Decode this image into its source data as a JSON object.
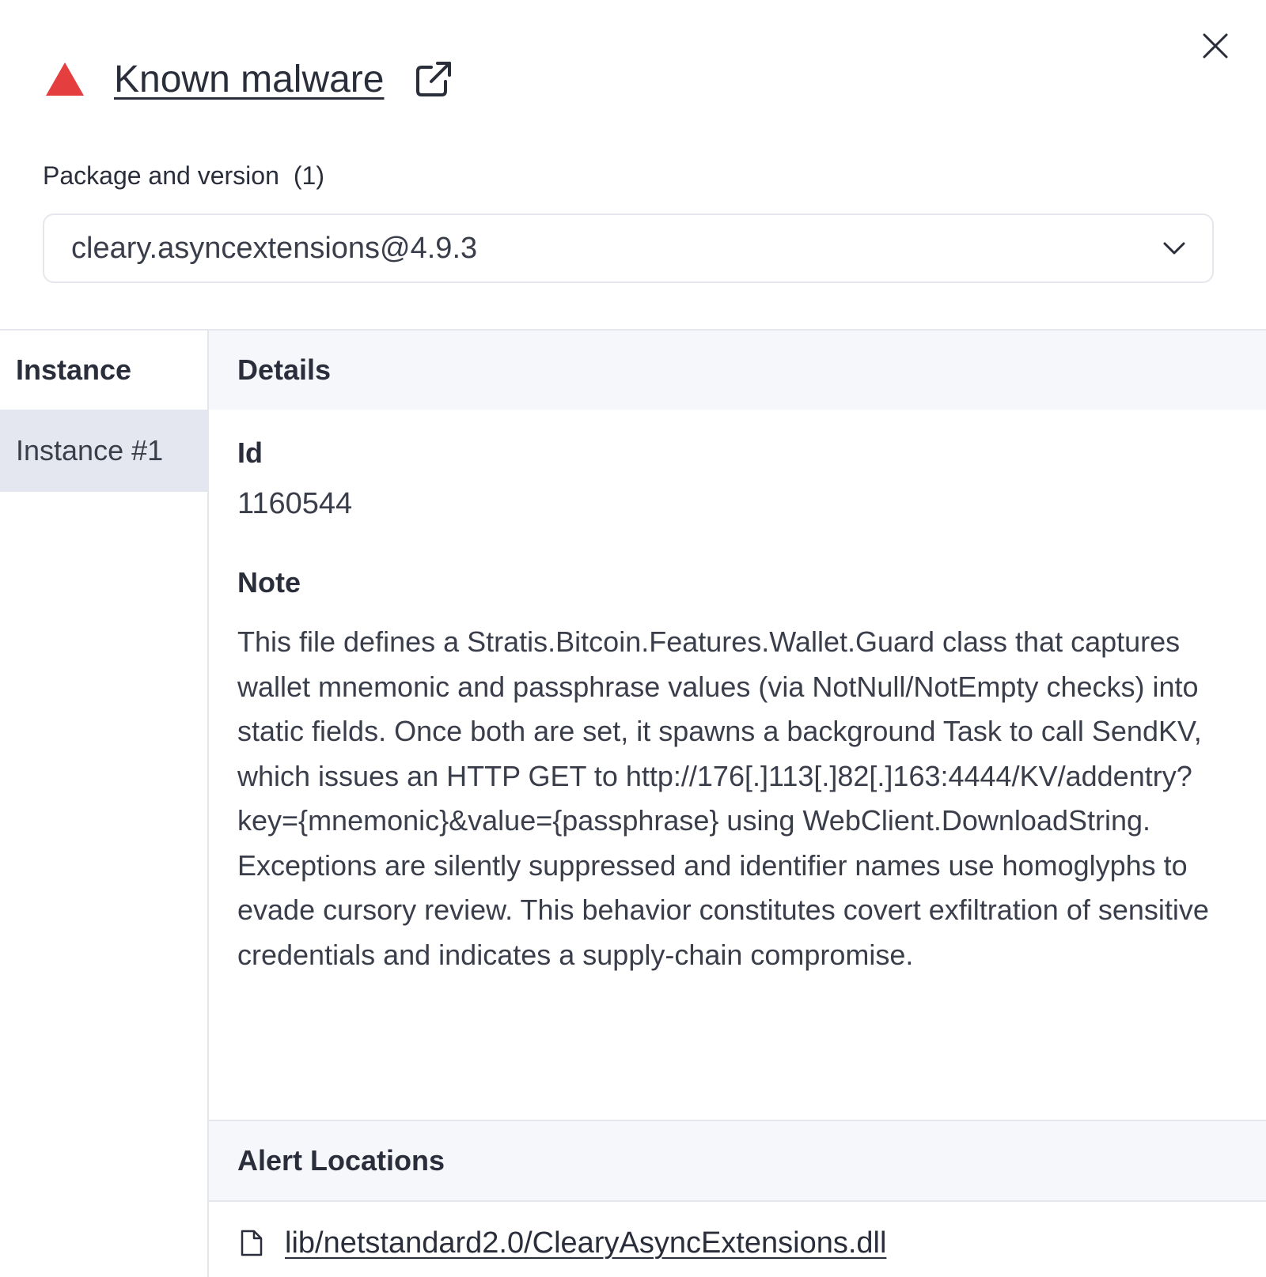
{
  "header": {
    "title": "Known malware",
    "warning_icon": "warning-triangle-icon",
    "warning_color": "#e53e3e",
    "external_link_icon": "external-link-icon",
    "close_icon": "close-icon"
  },
  "package": {
    "label": "Package and version",
    "count": "(1)",
    "selected": "cleary.asyncextensions@4.9.3",
    "dropdown_icon": "chevron-down-icon"
  },
  "instances": {
    "header": "Instance",
    "items": [
      {
        "label": "Instance #1",
        "selected": true
      }
    ]
  },
  "details": {
    "header": "Details",
    "id_label": "Id",
    "id_value": "1160544",
    "note_label": "Note",
    "note_text": "This file defines a Stratis.Bitcoin.Features.Wallet.Guard class that captures wallet mnemonic and passphrase values (via NotNull/NotEmpty checks) into static fields. Once both are set, it spawns a background Task to call SendKV, which issues an HTTP GET to http://176[.]113[.]82[.]163:4444/KV/addentry?key={mnemonic}&value={passphrase} using WebClient.DownloadString. Exceptions are silently suppressed and identifier names use homoglyphs to evade cursory review. This behavior constitutes covert exfiltration of sensitive credentials and indicates a supply-chain compromise."
  },
  "alert_locations": {
    "header": "Alert Locations",
    "items": [
      {
        "path": "lib/netstandard2.0/ClearyAsyncExtensions.dll",
        "icon": "file-icon"
      }
    ]
  }
}
